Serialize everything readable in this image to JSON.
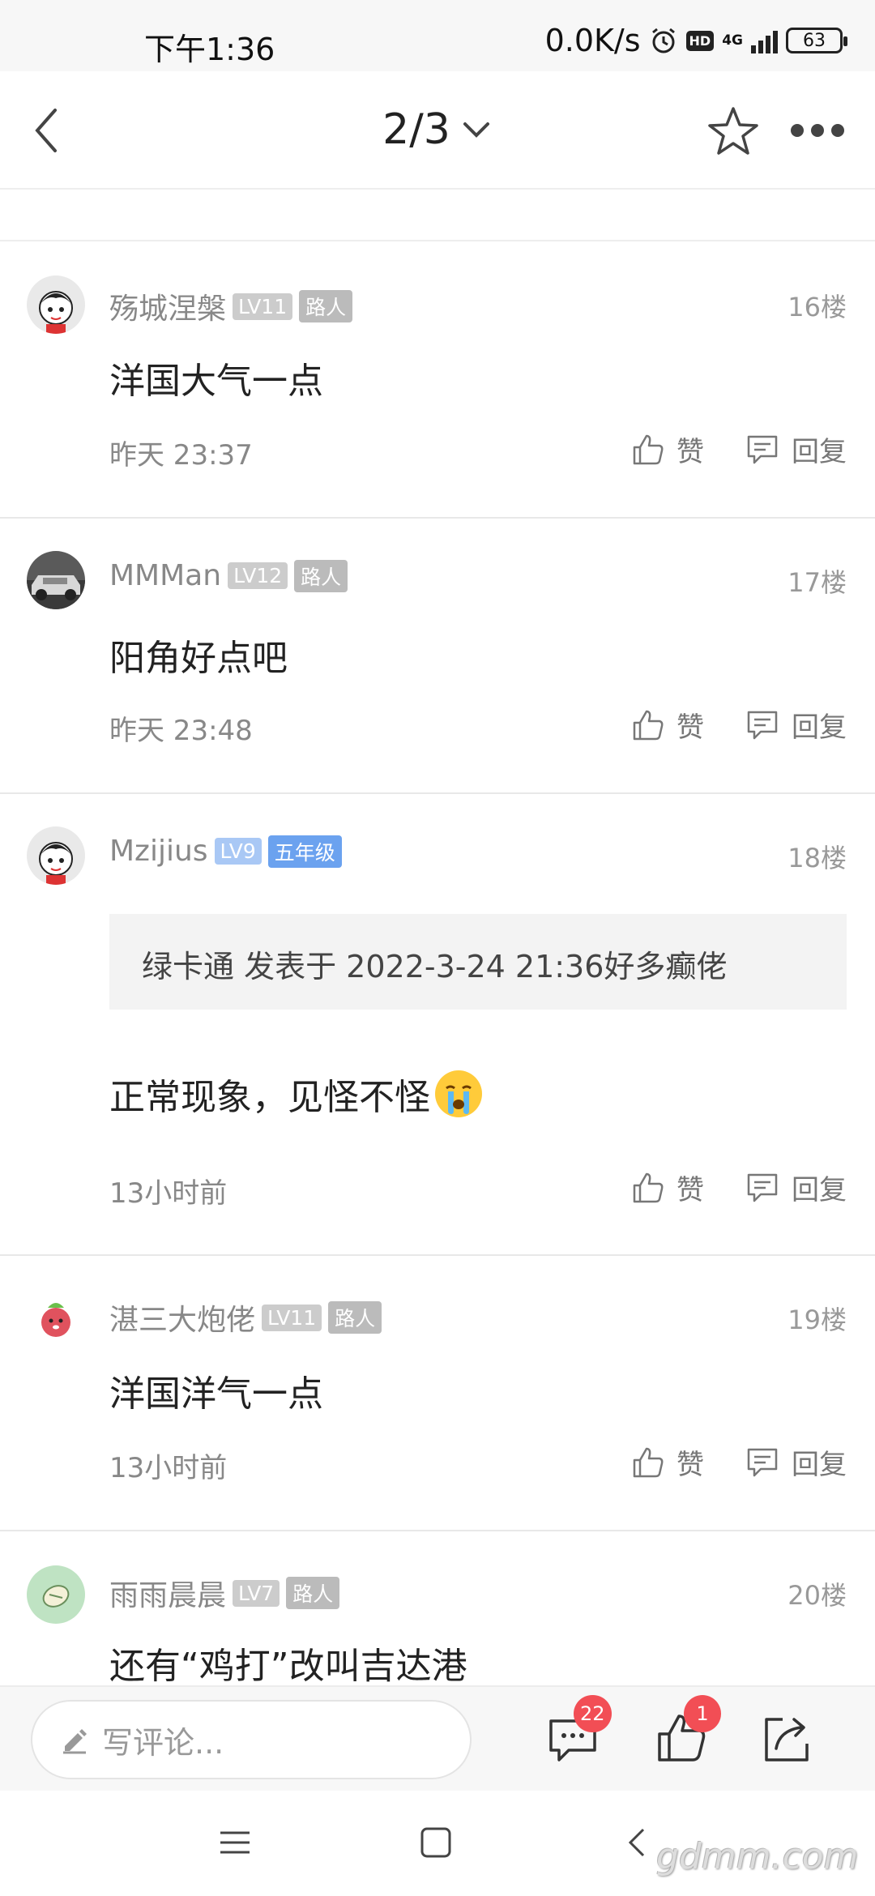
{
  "status_bar": {
    "time": "下午1:36",
    "speed": "0.0K/s",
    "network": "4G",
    "battery": "63"
  },
  "header": {
    "page_indicator": "2/3"
  },
  "comments": [
    {
      "username": "殇城涅槃",
      "level": "LV11",
      "title": "路人",
      "floor": "16楼",
      "text": "洋国大气一点",
      "time": "昨天  23:37",
      "like_label": "赞",
      "reply_label": "回复"
    },
    {
      "username": "MMMan",
      "level": "LV12",
      "title": "路人",
      "floor": "17楼",
      "text": "阳角好点吧",
      "time": "昨天  23:48",
      "like_label": "赞",
      "reply_label": "回复"
    },
    {
      "username": "Mzijius",
      "level": "LV9",
      "title": "五年级",
      "floor": "18楼",
      "quote": "绿卡通  发表于  2022-3-24  21:36好多癫佬",
      "text": "正常现象，见怪不怪",
      "time": "13小时前",
      "like_label": "赞",
      "reply_label": "回复"
    },
    {
      "username": "湛三大炮佬",
      "level": "LV11",
      "title": "路人",
      "floor": "19楼",
      "text": "洋国洋气一点",
      "time": "13小时前",
      "like_label": "赞",
      "reply_label": "回复"
    },
    {
      "username": "雨雨晨晨",
      "level": "LV7",
      "title": "路人",
      "floor": "20楼",
      "text": "还有“鸡打”改叫吉达港"
    }
  ],
  "bottom_bar": {
    "comment_placeholder": "写评论...",
    "comment_count": "22",
    "like_count": "1"
  },
  "watermark": "gdmm.com",
  "colors": {
    "badge": "#f24e55",
    "level_badge": "#cccccc",
    "level_badge_blue": "#a9c8f5",
    "title_badge_blue": "#6ba2ef"
  }
}
